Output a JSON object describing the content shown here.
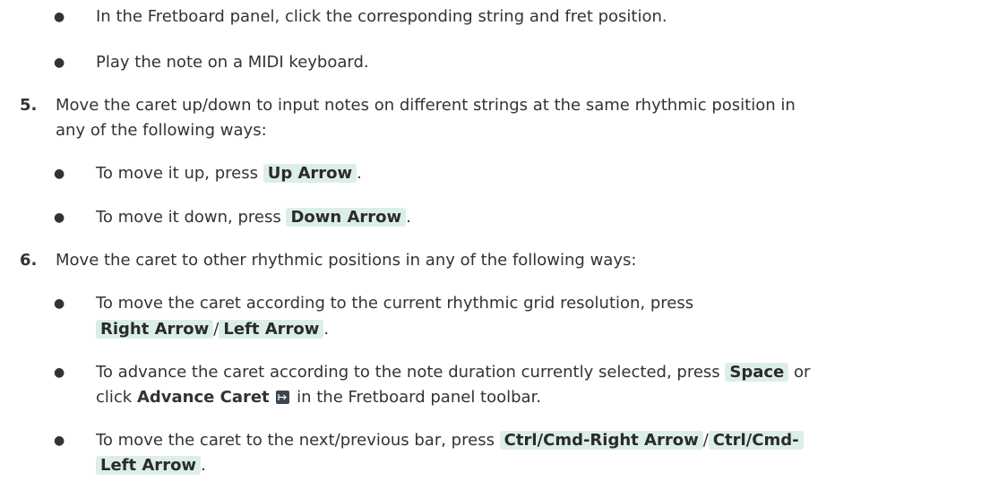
{
  "b_fretboard": "In the Fretboard panel, click the corresponding string and fret position.",
  "b_midi": "Play the note on a MIDI keyboard.",
  "step5": {
    "num": "5.",
    "line1": "Move the caret up/down to input notes on different strings at the same rhythmic position in",
    "line2": "any of the following ways:",
    "up": {
      "pre": "To move it up, press ",
      "key": "Up Arrow",
      "post": "."
    },
    "down": {
      "pre": "To move it down, press ",
      "key": "Down Arrow",
      "post": "."
    }
  },
  "step6": {
    "num": "6.",
    "line1": "Move the caret to other rhythmic positions in any of the following ways:",
    "grid": {
      "text": "To move the caret according to the current rhythmic grid resolution, press",
      "key1": "Right Arrow",
      "sep": "/",
      "key2": "Left Arrow",
      "post": "."
    },
    "advance": {
      "pre": "To advance the caret according to the note duration currently selected, press ",
      "key": "Space",
      "mid": " or",
      "l2_pre": "click ",
      "strong": "Advance Caret",
      "icon": "advance-caret-icon",
      "l2_post": " in the Fretboard panel toolbar."
    },
    "bar": {
      "pre": "To move the caret to the next/previous bar, press ",
      "key1": "Ctrl/Cmd-Right Arrow",
      "sep": "/",
      "key2a": "Ctrl/Cmd-",
      "key2b": "Left Arrow",
      "post": "."
    }
  }
}
